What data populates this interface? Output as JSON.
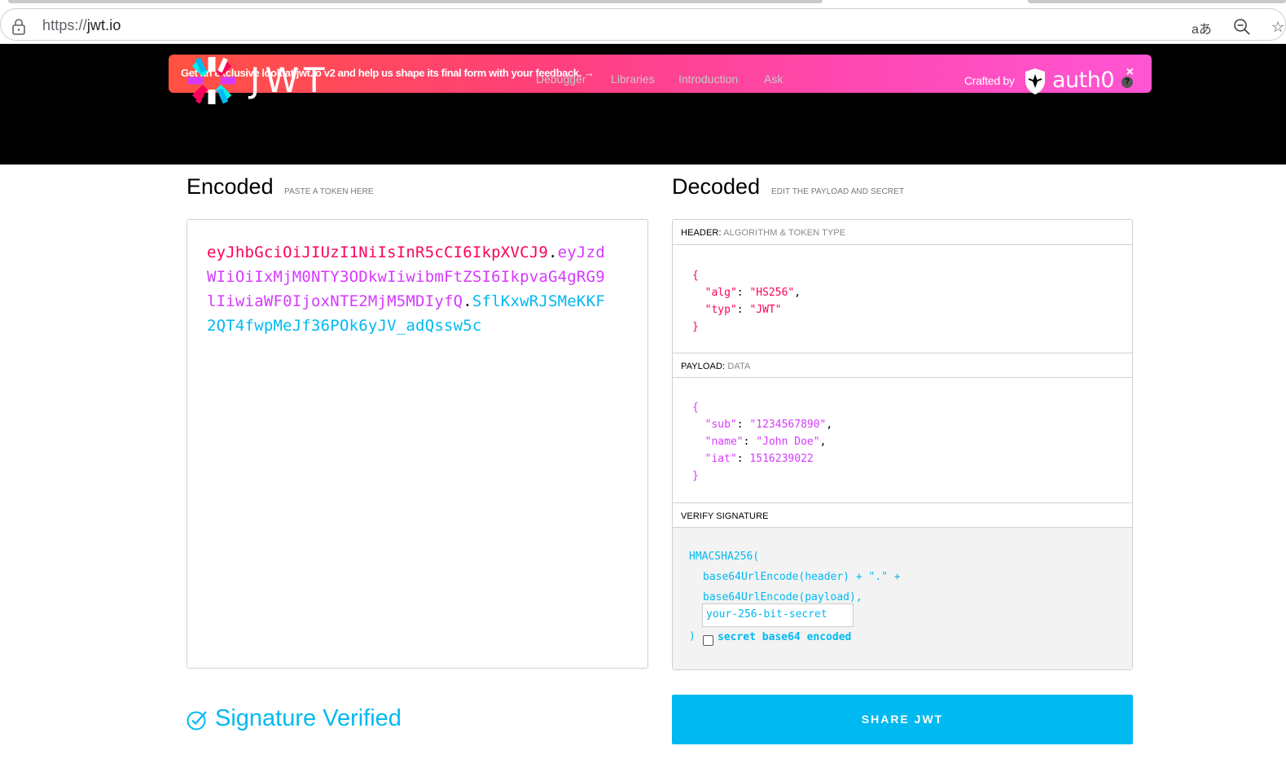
{
  "browser": {
    "url_protocol": "https://",
    "url_host": "jwt.io",
    "translate_glyph": "aあ",
    "star_glyph": "☆"
  },
  "banner": {
    "text": "Get an exclusive look at jwt.io v2 and help us shape its final form with your feedback. →",
    "close": "×"
  },
  "logo": {
    "text": "JWT"
  },
  "nav": [
    "Debugger",
    "Libraries",
    "Introduction",
    "Ask"
  ],
  "crafted": {
    "label": "Crafted by",
    "brand": "auth0",
    "help": "?"
  },
  "encoded": {
    "title": "Encoded",
    "subtitle": "PASTE A TOKEN HERE",
    "token_header": "eyJhbGciOiJIUzI1NiIsInR5cCI6IkpXVCJ9",
    "token_payload": "eyJzdWIiOiIxMjM0NTY3ODkwIiwibmFtZSI6IkpvaG4gRG9lIiwiaWF0IjoxNTE2MjM5MDIyfQ",
    "token_signature": "SflKxwRJSMeKKF2QT4fwpMeJf36POk6yJV_adQssw5c",
    "dot": "."
  },
  "decoded": {
    "title": "Decoded",
    "subtitle": "EDIT THE PAYLOAD AND SECRET",
    "header_label": "HEADER:",
    "header_sub": "ALGORITHM & TOKEN TYPE",
    "header_json": {
      "open": "{",
      "alg_key": "\"alg\"",
      "alg_val": "\"HS256\"",
      "typ_key": "\"typ\"",
      "typ_val": "\"JWT\"",
      "close": "}"
    },
    "payload_label": "PAYLOAD:",
    "payload_sub": "DATA",
    "payload_json": {
      "open": "{",
      "sub_key": "\"sub\"",
      "sub_val": "\"1234567890\"",
      "name_key": "\"name\"",
      "name_val": "\"John Doe\"",
      "iat_key": "\"iat\"",
      "iat_val": "1516239022",
      "close": "}"
    },
    "verify_label": "VERIFY SIGNATURE",
    "verify": {
      "line1": "HMACSHA256(",
      "line2": "base64UrlEncode(header) + \".\" +",
      "line3": "base64UrlEncode(payload),",
      "secret_value": "your-256-bit-secret",
      "closing": ")",
      "b64_label": "secret base64 encoded"
    }
  },
  "status": {
    "verified_text": "Signature Verified"
  },
  "share": {
    "label": "SHARE JWT"
  },
  "colors": {
    "header": "#fb015b",
    "payload": "#d63aff",
    "signature": "#00b9f1"
  }
}
